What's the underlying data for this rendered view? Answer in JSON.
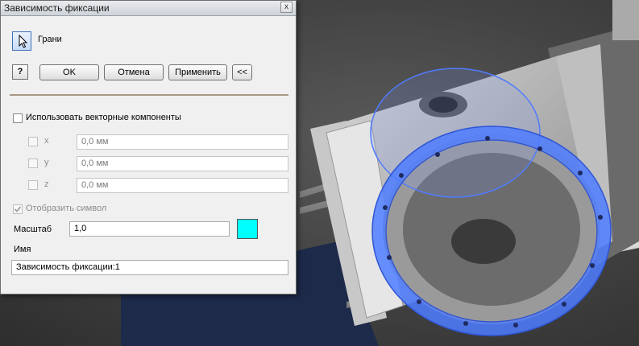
{
  "dialog": {
    "title": "Зависимость фиксации",
    "close_glyph": "x",
    "faces_label": "Грани",
    "help_glyph": "?",
    "buttons": {
      "ok": "OK",
      "cancel": "Отмена",
      "apply": "Применить",
      "expand": "<<"
    },
    "use_vector_components": {
      "label": "Использовать векторные компоненты",
      "checked": false
    },
    "components": [
      {
        "axis": "x",
        "value": "0,0 мм"
      },
      {
        "axis": "y",
        "value": "0,0 мм"
      },
      {
        "axis": "z",
        "value": "0,0 мм"
      }
    ],
    "show_symbol": {
      "label": "Отобразить символ",
      "checked": true
    },
    "scale_label": "Масштаб",
    "scale_value": "1,0",
    "symbol_color": "#00ffff",
    "name_label": "Имя",
    "name_value": "Зависимость фиксации:1"
  },
  "icons": {
    "faces": "cursor-arrow-icon",
    "help": "help-icon",
    "close": "close-icon"
  },
  "viewport": {
    "highlight_color": "#4f7cff"
  }
}
